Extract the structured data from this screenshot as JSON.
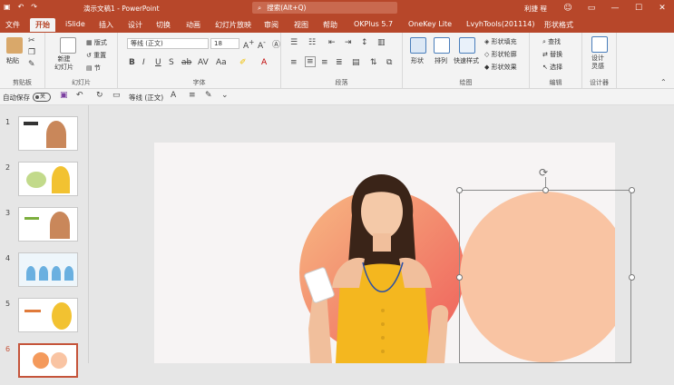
{
  "titlebar": {
    "autosave_icon": "save-icon",
    "title": "演示文稿1  -  PowerPoint",
    "search_placeholder": "搜索(Alt+Q)",
    "user": "利捷 程",
    "colors": {
      "brand": "#b7472a",
      "search_bg": "#c9694f"
    }
  },
  "tabs": [
    "文件",
    "开始",
    "iSlide",
    "插入",
    "设计",
    "切换",
    "动画",
    "幻灯片放映",
    "审阅",
    "视图",
    "帮助",
    "OKPlus 5.7",
    "OneKey Lite",
    "LvyhTools(201114)",
    "形状格式"
  ],
  "active_tab": "开始",
  "ribbon": {
    "clipboard": {
      "paste": "粘贴",
      "label": "剪贴板"
    },
    "slides": {
      "new_slide": "新建\n幻灯片",
      "layout": "版式",
      "reset": "重置",
      "section": "节",
      "label": "幻灯片"
    },
    "font": {
      "font_name": "等线 (正文)",
      "font_size": "18",
      "label": "字体"
    },
    "paragraph": {
      "label": "段落"
    },
    "drawing": {
      "shapes": "形状",
      "arrange": "排列",
      "quick_styles": "快速样式",
      "fill": "形状填充",
      "outline": "形状轮廓",
      "effects": "形状效果",
      "label": "绘图"
    },
    "editing": {
      "find": "查找",
      "replace": "替换",
      "select": "选择",
      "label": "编辑"
    },
    "designer": {
      "design_ideas": "设计\n灵感",
      "label": "设计器"
    }
  },
  "qat": {
    "autosave": "自动保存",
    "toggle": "关",
    "font": "等线 (正文)"
  },
  "thumbnails": [
    {
      "num": "1",
      "selected": false
    },
    {
      "num": "2",
      "selected": false
    },
    {
      "num": "3",
      "selected": false
    },
    {
      "num": "4",
      "selected": false
    },
    {
      "num": "5",
      "selected": false
    },
    {
      "num": "6",
      "selected": true
    }
  ],
  "slide": {
    "accent_gradient_start": "#f6b07a",
    "accent_gradient_end": "#f0685c",
    "selected_circle": "#f9c4a3",
    "dress": "#f4b71f"
  }
}
